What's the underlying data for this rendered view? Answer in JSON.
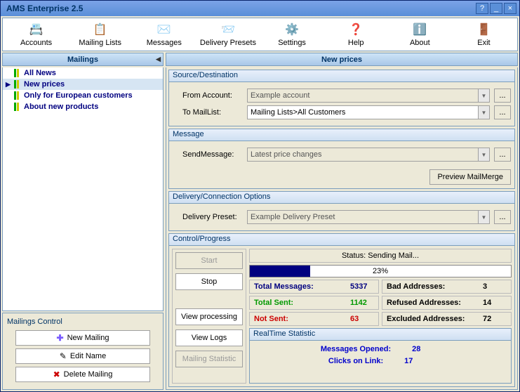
{
  "window": {
    "title": "AMS Enterprise 2.5"
  },
  "toolbar": [
    {
      "label": "Accounts",
      "icon": "📇"
    },
    {
      "label": "Mailing Lists",
      "icon": "📋"
    },
    {
      "label": "Messages",
      "icon": "✉️"
    },
    {
      "label": "Delivery Presets",
      "icon": "📨"
    },
    {
      "label": "Settings",
      "icon": "⚙️"
    },
    {
      "label": "Help",
      "icon": "❓"
    },
    {
      "label": "About",
      "icon": "ℹ️"
    },
    {
      "label": "Exit",
      "icon": "🚪"
    }
  ],
  "mailings": {
    "title": "Mailings",
    "items": [
      {
        "label": "All News"
      },
      {
        "label": "New prices"
      },
      {
        "label": "Only for European customers"
      },
      {
        "label": "About new products"
      }
    ],
    "control": {
      "title": "Mailings Control",
      "new": "New Mailing",
      "edit": "Edit Name",
      "del": "Delete Mailing"
    }
  },
  "detail": {
    "title": "New prices",
    "source": {
      "head": "Source/Destination",
      "from_lbl": "From Account:",
      "from_val": "Example account",
      "to_lbl": "To MailList:",
      "to_val": "Mailing Lists>All Customers"
    },
    "message": {
      "head": "Message",
      "send_lbl": "SendMessage:",
      "send_val": "Latest price changes",
      "preview": "Preview MailMerge"
    },
    "delivery": {
      "head": "Delivery/Connection Options",
      "preset_lbl": "Delivery Preset:",
      "preset_val": "Example Delivery Preset"
    },
    "progress": {
      "head": "Control/Progress",
      "start": "Start",
      "stop": "Stop",
      "vp": "View processing",
      "vl": "View Logs",
      "ms": "Mailing Statistic",
      "status_lbl": "Status: ",
      "status_val": "Sending Mail...",
      "pct": "23%",
      "tm_lbl": "Total Messages:",
      "tm_val": "5337",
      "ba_lbl": "Bad Addresses:",
      "ba_val": "3",
      "ts_lbl": "Total Sent:",
      "ts_val": "1142",
      "ra_lbl": "Refused Addresses:",
      "ra_val": "14",
      "ns_lbl": "Not Sent:",
      "ns_val": "63",
      "ea_lbl": "Excluded Addresses:",
      "ea_val": "72",
      "rt_head": "RealTime Statistic",
      "mo_lbl": "Messages Opened:",
      "mo_val": "28",
      "cl_lbl": "Clicks on Link:",
      "cl_val": "17"
    }
  },
  "dots": "..."
}
